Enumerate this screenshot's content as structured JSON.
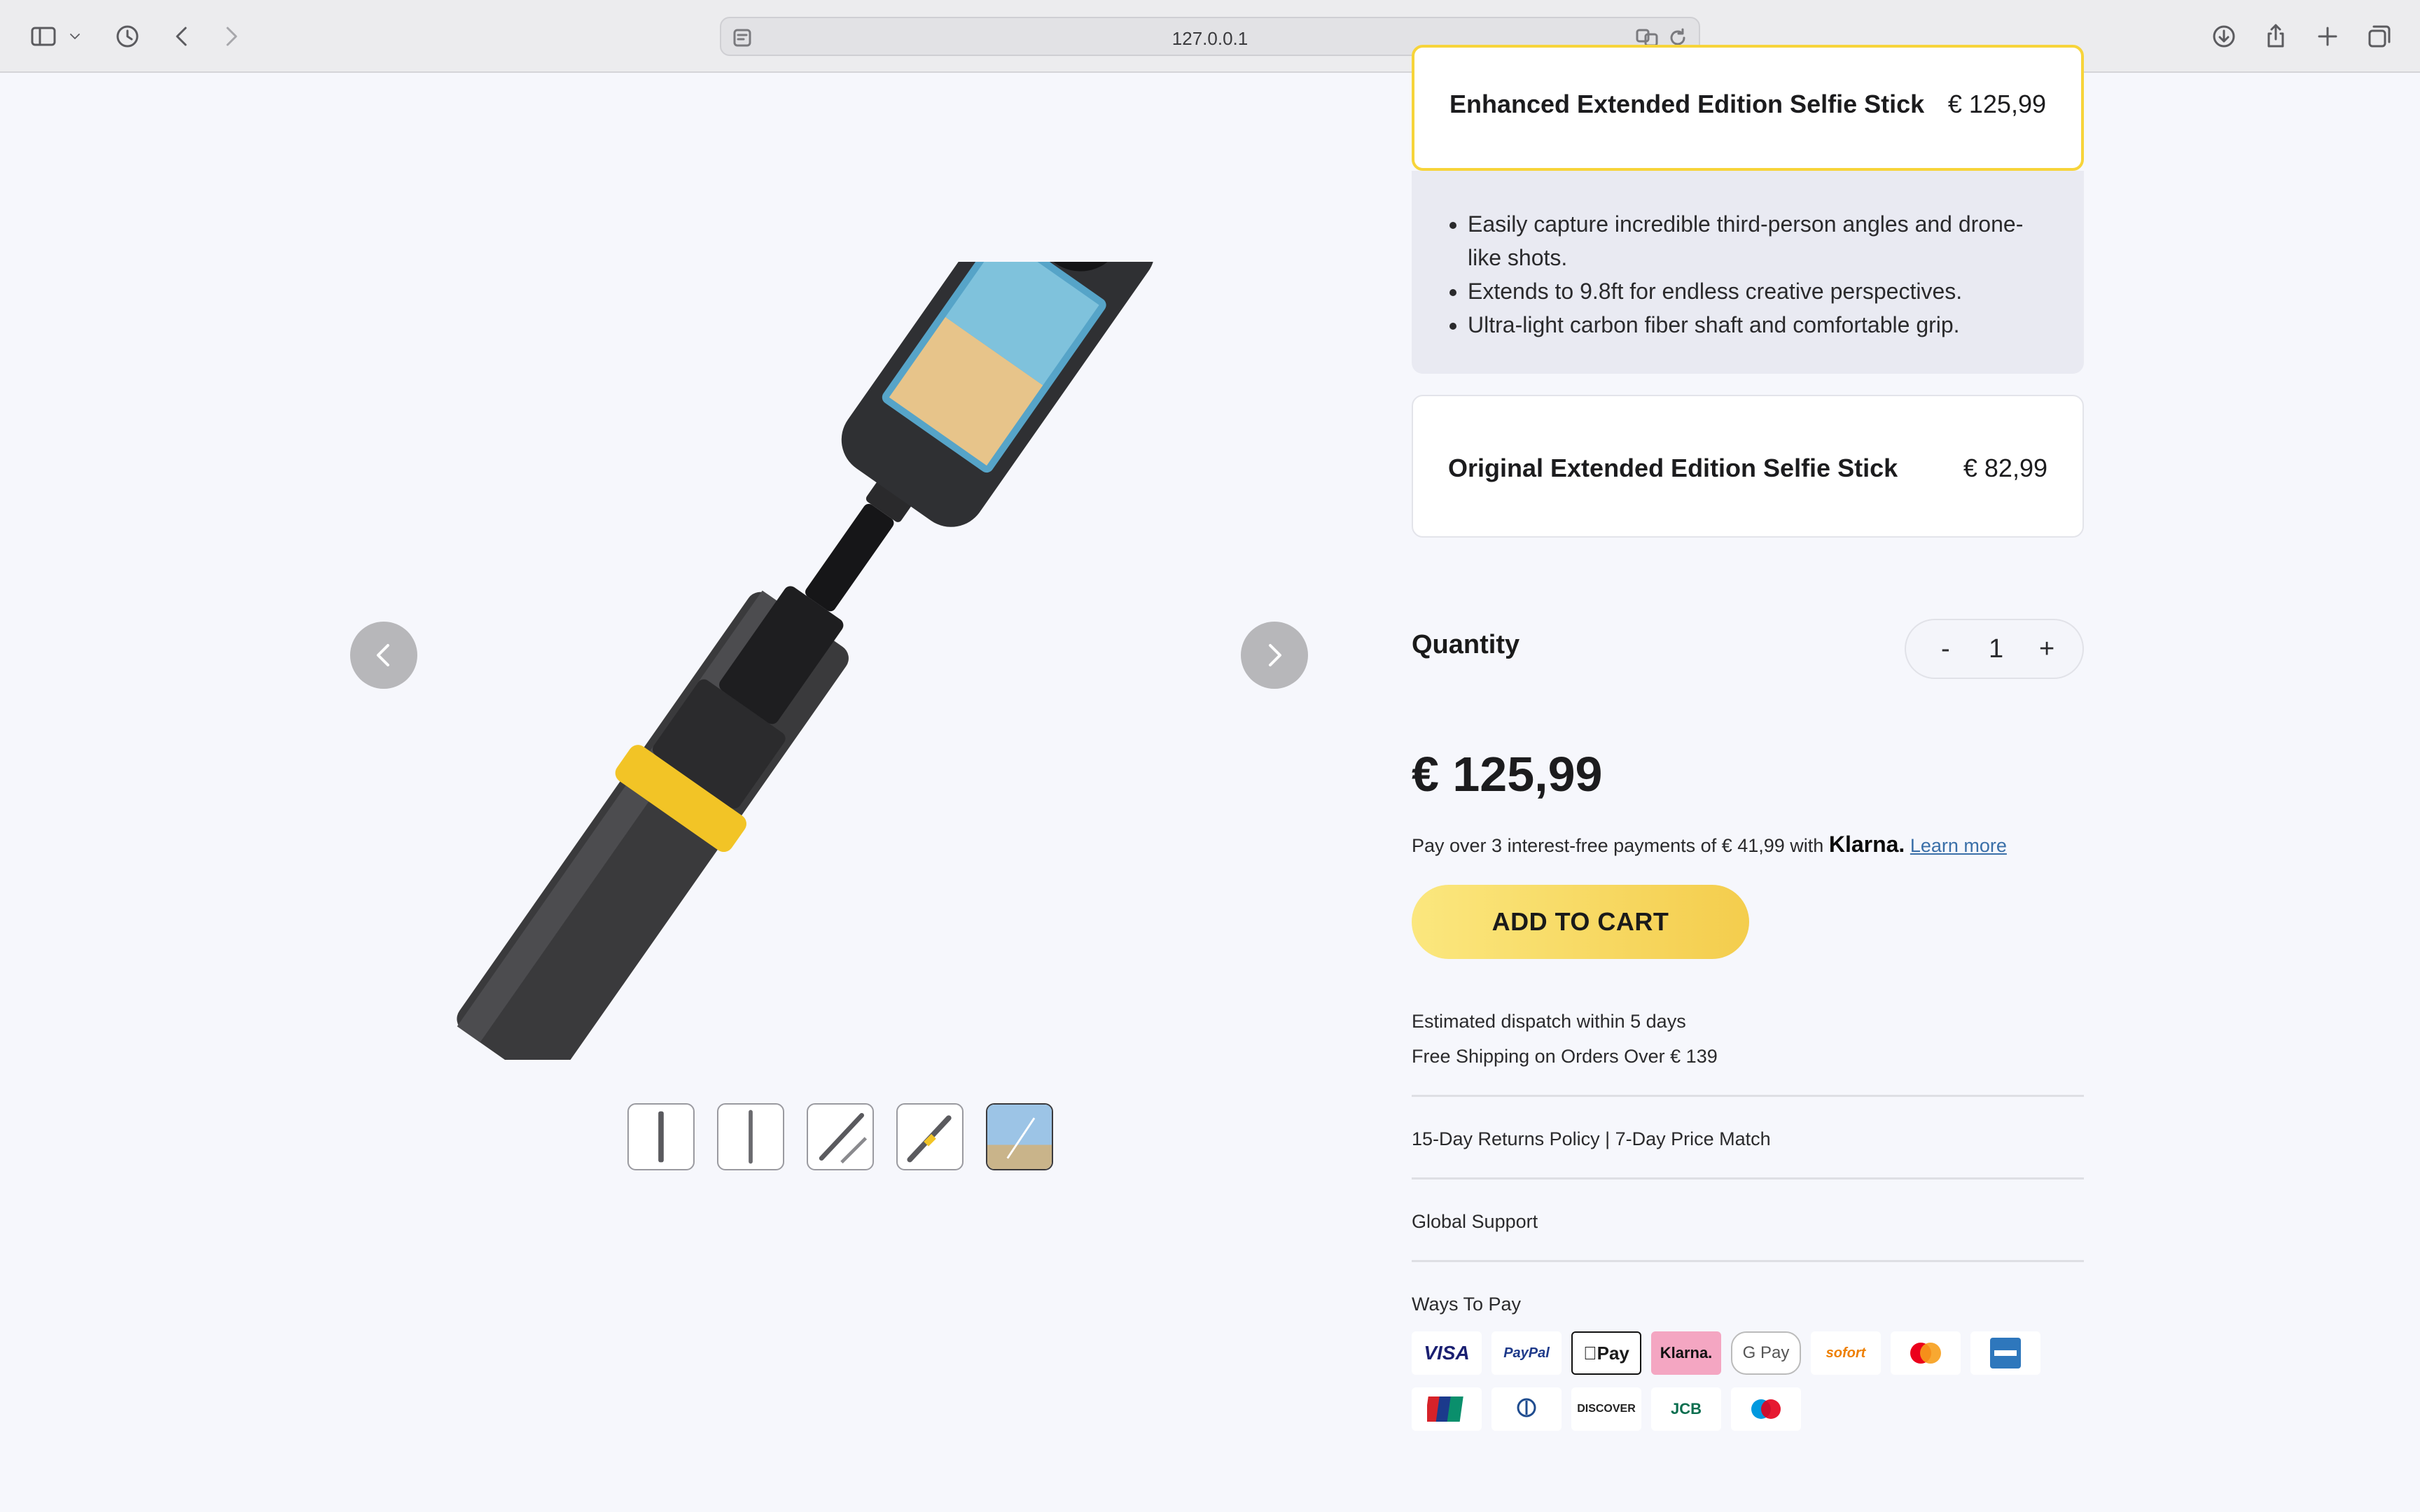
{
  "browser": {
    "url": "127.0.0.1"
  },
  "gallery": {
    "thumbnails": [
      "thumb-1",
      "thumb-2",
      "thumb-3",
      "thumb-4",
      "thumb-5"
    ]
  },
  "options": [
    {
      "name": "Enhanced Extended Edition Selfie Stick",
      "price": "€ 125,99",
      "selected": true,
      "features": [
        "Easily capture incredible third-person angles and drone-like shots.",
        "Extends to 9.8ft for endless creative perspectives.",
        "Ultra-light carbon fiber shaft and comfortable grip."
      ]
    },
    {
      "name": "Original Extended Edition Selfie Stick",
      "price": "€ 82,99",
      "selected": false
    }
  ],
  "quantity": {
    "label": "Quantity",
    "minus": "-",
    "value": "1",
    "plus": "+"
  },
  "price": {
    "total": "€ 125,99",
    "klarna_prefix": "Pay over 3 interest-free payments of € 41,99 with",
    "klarna_brand": "Klarna.",
    "learn_more": "Learn more"
  },
  "cart": {
    "add_to_cart": "ADD TO CART"
  },
  "shipping": {
    "dispatch": "Estimated dispatch within 5 days",
    "free_shipping": "Free Shipping on Orders Over € 139"
  },
  "policies": {
    "returns": "15-Day Returns Policy | 7-Day Price Match",
    "support": "Global Support",
    "ways_to_pay": "Ways To Pay"
  },
  "payment_methods": {
    "visa": "VISA",
    "paypal": "PayPal",
    "applepay": "Pay",
    "klarna": "Klarna.",
    "googlepay": "G Pay",
    "sofort": "sofort",
    "discover": "DISCOVER",
    "jcb": "JCB"
  }
}
